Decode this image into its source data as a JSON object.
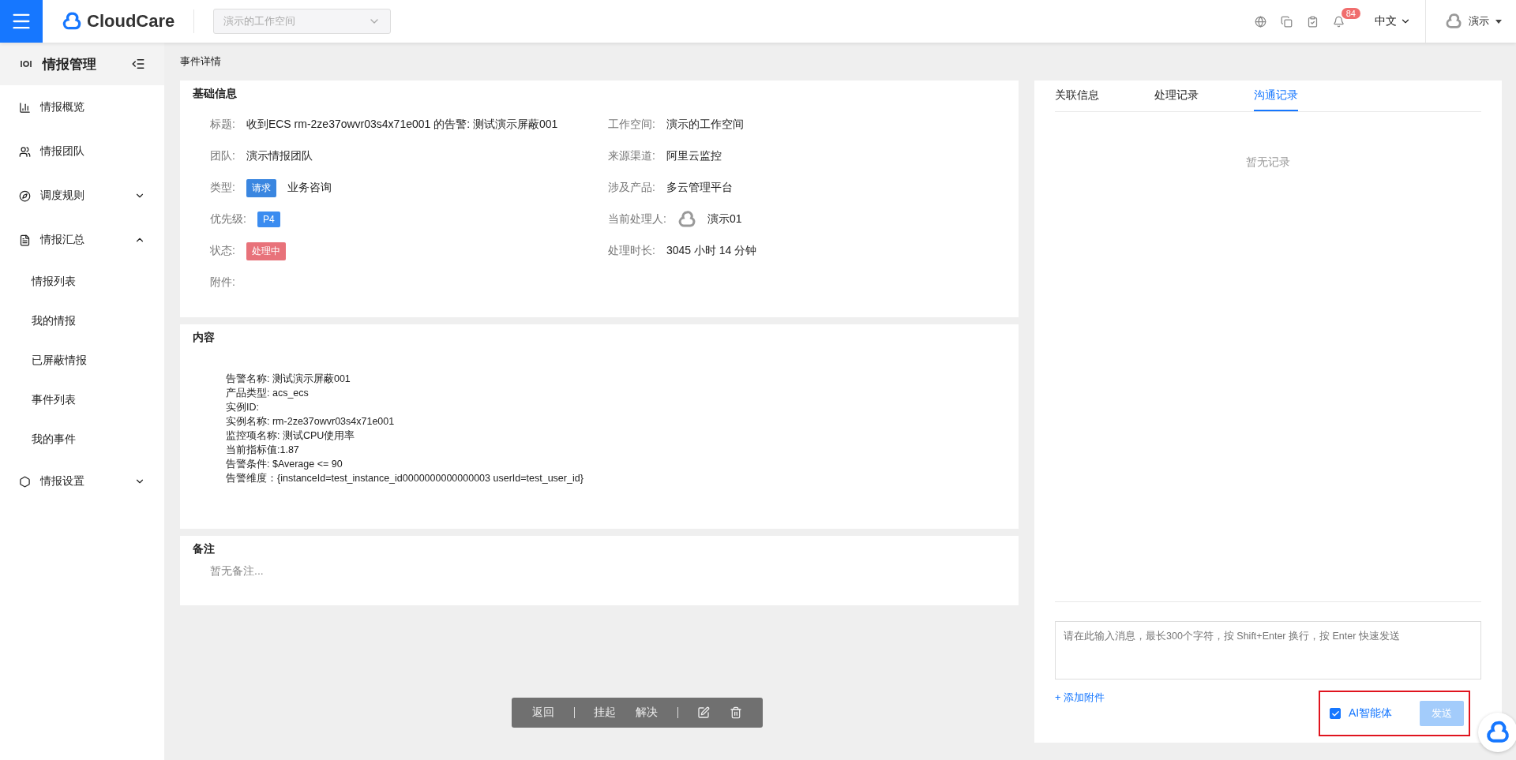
{
  "topbar": {
    "logo": "CloudCare",
    "workspace": {
      "placeholder": "演示的工作空间"
    },
    "notifications": "84",
    "language": "中文",
    "user": "演示"
  },
  "sidebar": {
    "title": "情报管理",
    "items": [
      {
        "kind": "link",
        "label": "情报概览"
      },
      {
        "kind": "link",
        "label": "情报团队"
      },
      {
        "kind": "group",
        "label": "调度规则",
        "expanded": false
      },
      {
        "kind": "group",
        "label": "情报汇总",
        "expanded": true,
        "children": [
          {
            "label": "情报列表"
          },
          {
            "label": "我的情报"
          },
          {
            "label": "已屏蔽情报"
          },
          {
            "label": "事件列表"
          },
          {
            "label": "我的事件"
          }
        ]
      },
      {
        "kind": "group",
        "label": "情报设置",
        "expanded": false
      }
    ]
  },
  "breadcrumb": "事件详情",
  "basic_info": {
    "title": "基础信息",
    "left": [
      {
        "label": "标题:",
        "kind": "text",
        "value": "收到ECS rm-2ze37owvr03s4x71e001 的告警: 测试演示屏蔽001"
      },
      {
        "label": "团队:",
        "kind": "text",
        "value": "演示情报团队"
      },
      {
        "label": "类型:",
        "kind": "tag",
        "tag": "请求",
        "color": "#3a86e0",
        "value": "业务咨询"
      },
      {
        "label": "优先级:",
        "kind": "tag",
        "tag": "P4",
        "color": "#3b8cf0"
      },
      {
        "label": "状态:",
        "kind": "tag",
        "tag": "处理中",
        "color": "#e8727a"
      },
      {
        "label": "附件:",
        "kind": "text"
      }
    ],
    "right": [
      {
        "label": "工作空间:",
        "kind": "text",
        "value": "演示的工作空间"
      },
      {
        "label": "来源渠道:",
        "kind": "text",
        "value": "阿里云监控"
      },
      {
        "label": "涉及产品:",
        "kind": "text",
        "value": "多云管理平台"
      },
      {
        "label": "当前处理人:",
        "kind": "avatar",
        "value": "演示01"
      },
      {
        "label": "处理时长:",
        "kind": "text",
        "value": "3045 小时 14 分钟"
      }
    ]
  },
  "content": {
    "title": "内容",
    "lines": [
      "告警名称: 测试演示屏蔽001",
      "产品类型: acs_ecs",
      "实例ID:",
      "实例名称: rm-2ze37owvr03s4x71e001",
      "监控项名称: 测试CPU使用率",
      "当前指标值:1.87",
      "告警条件: $Average <= 90",
      "告警维度：{instanceId=test_instance_id0000000000000003 userId=test_user_id}"
    ]
  },
  "notes": {
    "title": "备注",
    "empty": "暂无备注..."
  },
  "actions": [
    {
      "kind": "text",
      "label": "返回"
    },
    {
      "kind": "divider"
    },
    {
      "kind": "text",
      "label": "挂起"
    },
    {
      "kind": "text",
      "label": "解决"
    },
    {
      "kind": "divider"
    },
    {
      "kind": "edit"
    },
    {
      "kind": "delete"
    }
  ],
  "panel": {
    "tabs": [
      {
        "label": "关联信息",
        "selected": false
      },
      {
        "label": "处理记录",
        "selected": false
      },
      {
        "label": "沟通记录",
        "selected": true
      }
    ],
    "empty": "暂无记录",
    "message": {
      "placeholder": "请在此输入消息，最长300个字符，按 Shift+Enter 换行，按 Enter 快速发送"
    },
    "attach": "+ 添加附件",
    "ai_agent": {
      "label": "AI智能体",
      "checked": true
    },
    "send": {
      "label": "发送",
      "disabled": true
    }
  }
}
